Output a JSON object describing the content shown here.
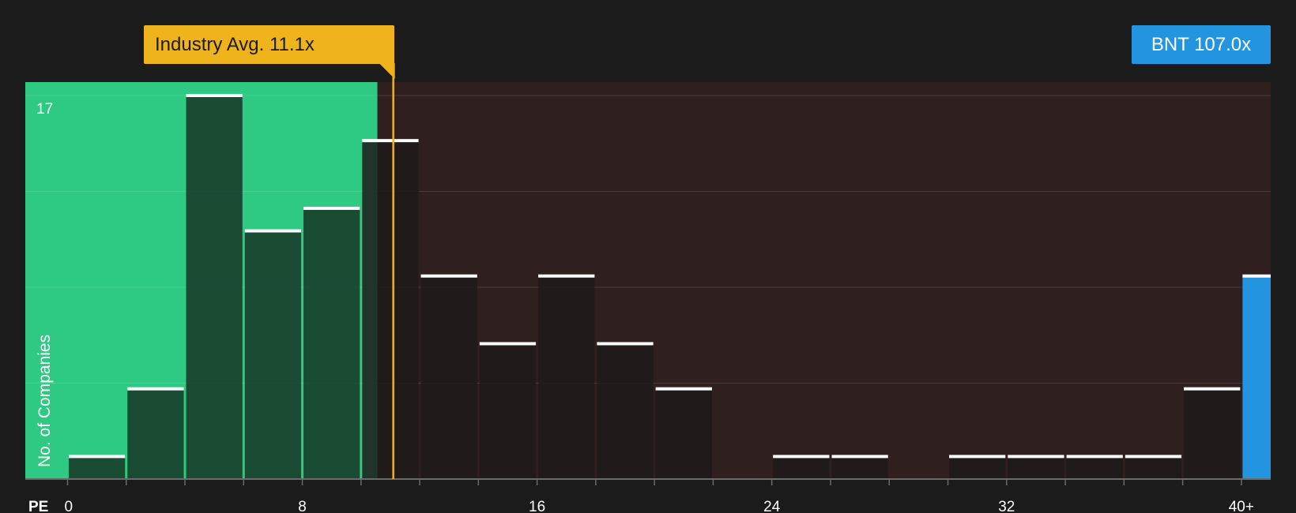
{
  "industry_avg_label": "Industry Avg. 11.1x",
  "company_label": "BNT 107.0x",
  "colors": {
    "background": "#1b1b1b",
    "green_zone": "#2ec982",
    "red_zone": "#2f1f1f",
    "industry_avg": "#efb31b",
    "company": "#2394e0",
    "grid": "#4a3a3a"
  },
  "chart_data": {
    "type": "bar",
    "xlabel": "PE",
    "ylabel": "No. of Companies",
    "y_tick_labels": [
      "17"
    ],
    "ylim": [
      0,
      17
    ],
    "x_tick_labels": [
      "0",
      "8",
      "16",
      "24",
      "32",
      "40+"
    ],
    "x_tick_values": [
      0,
      8,
      16,
      24,
      32,
      40
    ],
    "xlim": [
      -1.44,
      41
    ],
    "bin_width": 2,
    "bins": [
      {
        "start": 0,
        "end": 2,
        "count": 1
      },
      {
        "start": 2,
        "end": 4,
        "count": 4
      },
      {
        "start": 4,
        "end": 6,
        "count": 17
      },
      {
        "start": 6,
        "end": 8,
        "count": 11
      },
      {
        "start": 8,
        "end": 10,
        "count": 12
      },
      {
        "start": 10,
        "end": 12,
        "count": 15
      },
      {
        "start": 12,
        "end": 14,
        "count": 9
      },
      {
        "start": 14,
        "end": 16,
        "count": 6
      },
      {
        "start": 16,
        "end": 18,
        "count": 9
      },
      {
        "start": 18,
        "end": 20,
        "count": 6
      },
      {
        "start": 20,
        "end": 22,
        "count": 4
      },
      {
        "start": 22,
        "end": 24,
        "count": 0
      },
      {
        "start": 24,
        "end": 26,
        "count": 1
      },
      {
        "start": 26,
        "end": 28,
        "count": 1
      },
      {
        "start": 28,
        "end": 30,
        "count": 0
      },
      {
        "start": 30,
        "end": 32,
        "count": 1
      },
      {
        "start": 32,
        "end": 34,
        "count": 1
      },
      {
        "start": 34,
        "end": 36,
        "count": 1
      },
      {
        "start": 36,
        "end": 38,
        "count": 1
      },
      {
        "start": 38,
        "end": 40,
        "count": 4
      }
    ],
    "company_bin": {
      "start": 40,
      "end": 41,
      "count": 9
    },
    "industry_average": 11.1,
    "company_value": 107.0,
    "grid": true
  }
}
